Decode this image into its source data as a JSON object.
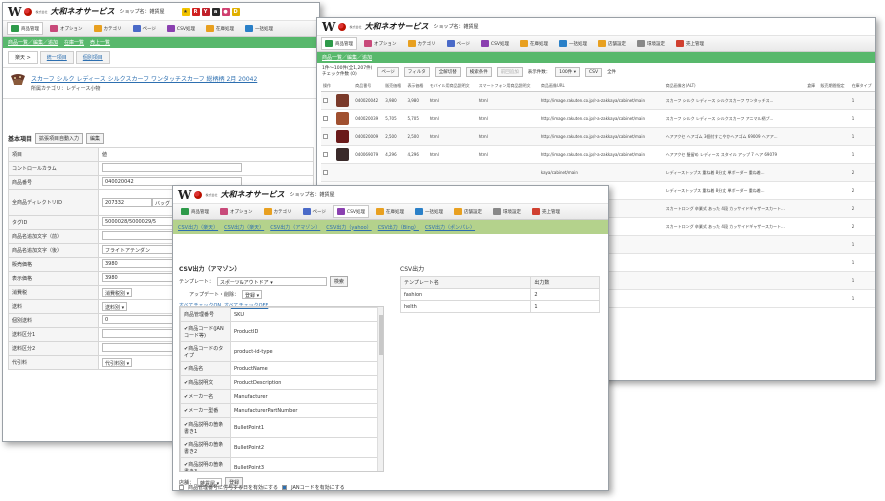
{
  "brand": {
    "w_logo": "W",
    "small": "株式会社",
    "name": "大和ネオサービス",
    "shop_label": "ショップ名：雑貨屋"
  },
  "tools": [
    {
      "glyph": "★",
      "color": "#e0a000"
    },
    {
      "glyph": "R",
      "color": "#d02020"
    },
    {
      "glyph": "Y",
      "color": "#c0202a"
    },
    {
      "glyph": "a",
      "color": "#2a2a2a"
    },
    {
      "glyph": "●",
      "color": "#d04070"
    },
    {
      "glyph": "D",
      "color": "#e0b000"
    }
  ],
  "menu": [
    {
      "label": "商品管理",
      "color": "#2e9a4a"
    },
    {
      "label": "オプション",
      "color": "#c84a7a"
    },
    {
      "label": "カテゴリ",
      "color": "#e8a020"
    },
    {
      "label": "ページ",
      "color": "#4a6ac8"
    },
    {
      "label": "CSV処理",
      "color": "#8a40b0"
    },
    {
      "label": "在庫処理",
      "color": "#e8a020"
    },
    {
      "label": "一括処理",
      "color": "#2a80c8"
    },
    {
      "label": "店舗設定",
      "color": "#e8a020"
    },
    {
      "label": "環境設定",
      "color": "#888888"
    },
    {
      "label": "売上管理",
      "color": "#d04030"
    }
  ],
  "win1": {
    "breadcrumb": [
      "商品一覧／編集／追加",
      "在庫一覧",
      "売上一覧"
    ],
    "subtabs": [
      "楽天 >",
      "統一項目",
      "個別項目"
    ],
    "product_title": "スカーフ シルク レディース シルクスカーフ ワンタッチスカーフ 総柄柄 2月 20042",
    "category": "所属カテゴリ：レディース小物",
    "section": "基本項目",
    "btn_auto": "拡張項目自動入力",
    "btn_edit": "編集",
    "rows": [
      {
        "label": "項目",
        "value": "値"
      },
      {
        "label": "コントロールカラム",
        "value": ""
      },
      {
        "label": "商品番号",
        "value": "040020042"
      },
      {
        "label": "全商品ディレクトリID",
        "value": "207332\nバッグ・小物・ブラン"
      },
      {
        "label": "タグID",
        "value": "5000028/5000029/5"
      },
      {
        "label": "商品名追加文字（前）",
        "value": ""
      },
      {
        "label": "商品名追加文字（後）",
        "value": "フライトアテンダン"
      },
      {
        "label": "販売価格",
        "value": "3980"
      },
      {
        "label": "表示価格",
        "value": "3980"
      },
      {
        "label": "消費税",
        "value": "消費税別 ▾"
      },
      {
        "label": "送料",
        "value": "送料別 ▾"
      },
      {
        "label": "個別送料",
        "value": "0"
      },
      {
        "label": "送料区分1",
        "value": ""
      },
      {
        "label": "送料区分2",
        "value": ""
      },
      {
        "label": "代引料",
        "value": "代引料別 ▾"
      }
    ]
  },
  "win2": {
    "breadcrumb": "商品一覧／編集／追加",
    "count_line1": "1件〜100件(全1,207件)",
    "count_line2": "チェック件数 (0)",
    "buttons": [
      "ページ",
      "フィルタ",
      "全解切替",
      "検索条件"
    ],
    "btn_disabled": "前回追加",
    "display_label": "表示件数：",
    "display_value": "100件 ▾",
    "csv_btn": "CSV",
    "all_label": "全件",
    "headers": [
      "操作",
      "",
      "商品番号",
      "販売価格",
      "表示価格",
      "モバイル用商品説明文",
      "スマートフォン用商品説明文",
      "商品画像URL",
      "",
      "商品画像名(ALT)",
      "",
      "倉庫",
      "販売期間指定",
      "在庫タイプ",
      "在庫数表示",
      "項目選"
    ],
    "rows": [
      {
        "id": "040020042",
        "price": "3,980",
        "disp": "3,980",
        "mob": "html",
        "sp": "html",
        "url": "http://image.rakuten.co.jp/r-a-zakkaya/cabinet/main",
        "alt": "スカーフ シルク レディース シルクスカーフ ワンタッチス...",
        "stock": "1",
        "opt": "",
        "thumb": "#7a3a2a"
      },
      {
        "id": "040020039",
        "price": "5,705",
        "disp": "5,705",
        "mob": "html",
        "sp": "html",
        "url": "http://image.rakuten.co.jp/r-a-zakkaya/cabinet/main",
        "alt": "スカーフ シルク レディース シルクスカーフ アニマル柄プ...",
        "stock": "1",
        "opt": "",
        "thumb": "#a05030"
      },
      {
        "id": "040020009",
        "price": "2,500",
        "disp": "2,500",
        "mob": "html",
        "sp": "html",
        "url": "http://image.rakuten.co.jp/r-a-zakkaya/cabinet/main",
        "alt": "ヘアアクセ ヘアゴム 3個付すこやかヘアゴム 69009 ヘアア...",
        "stock": "1",
        "opt": "",
        "thumb": "#6a1a1a"
      },
      {
        "id": "040069079",
        "price": "4,296",
        "disp": "4,296",
        "mob": "html",
        "sp": "html",
        "url": "http://image.rakuten.co.jp/r-a-zakkaya/cabinet/main",
        "alt": "ヘアアクセ 髪留め レディース スタイル アップ 7 ヘア 69079",
        "stock": "1",
        "opt": "",
        "thumb": "#3a2a2a"
      },
      {
        "id": "",
        "price": "",
        "disp": "",
        "mob": "",
        "sp": "",
        "url": "kaya/cabinet/main",
        "alt": "レディーストップス 重ね着 8分丈 単ボーダー 重ね着...",
        "stock": "2",
        "opt": "サイズ",
        "thumb": ""
      },
      {
        "id": "",
        "price": "",
        "disp": "",
        "mob": "",
        "sp": "",
        "url": "kaya/cabinet/main",
        "alt": "レディーストップス 重ね着 8分丈 単ボーダー 重ね着...",
        "stock": "2",
        "opt": "サイズ",
        "thumb": ""
      },
      {
        "id": "",
        "price": "",
        "disp": "",
        "mob": "",
        "sp": "",
        "url": "kaya/cabinet/main",
        "alt": "スカートロング 卒業式 あった 4段 カッサイドギャザースカート...",
        "stock": "2",
        "opt": "サイズ",
        "thumb": ""
      },
      {
        "id": "",
        "price": "",
        "disp": "",
        "mob": "",
        "sp": "",
        "url": "kaya/cabinet/main",
        "alt": "スカートロング 卒業式 あった 4段 カッサイドギャザースカート...",
        "stock": "2",
        "opt": "サイズ",
        "thumb": ""
      },
      {
        "id": "",
        "price": "",
        "disp": "",
        "mob": "",
        "sp": "",
        "url": "kaya/cabinet/1030",
        "alt": "",
        "stock": "1",
        "opt": "",
        "thumb": ""
      },
      {
        "id": "",
        "price": "",
        "disp": "",
        "mob": "",
        "sp": "",
        "url": "kaya/cabinet/1030",
        "alt": "",
        "stock": "1",
        "opt": "",
        "thumb": ""
      },
      {
        "id": "",
        "price": "",
        "disp": "",
        "mob": "",
        "sp": "",
        "url": "kaya/cabinet/1030",
        "alt": "",
        "stock": "1",
        "opt": "",
        "thumb": ""
      },
      {
        "id": "",
        "price": "",
        "disp": "",
        "mob": "",
        "sp": "",
        "url": "kaya/cabinet/1030",
        "alt": "",
        "stock": "1",
        "opt": "",
        "thumb": ""
      }
    ]
  },
  "win3": {
    "csv_links": [
      "CSV出力（楽天）",
      "CSV出力（楽天）",
      "CSV出力（アマゾン）",
      "CSV出力（yahoo）",
      "CSV出力（Bing）",
      "CSV出力（ポンパレ）"
    ],
    "title": "CSV出力（アマゾン）",
    "template_label": "テンプレート：",
    "template_value": "スポーツ&アウトドア ▾",
    "search_btn": "検索",
    "update_label": "アップデート・削除：",
    "update_value": "登録 ▾",
    "check_all": "すべてチェックON",
    "uncheck_all": "すべてチェックOFF",
    "fields": [
      {
        "label": "商品管理番号",
        "value": "SKU",
        "tall": false
      },
      {
        "label": "✔商品コード(JANコード等)",
        "value": "ProductID",
        "tall": true
      },
      {
        "label": "✔商品コードのタイプ",
        "value": "product-id-type",
        "tall": true
      },
      {
        "label": "✔商品名",
        "value": "ProductName",
        "tall": false
      },
      {
        "label": "✔商品説明文",
        "value": "ProductDescription",
        "tall": false
      },
      {
        "label": "✔メーカー名",
        "value": "Manufacturer",
        "tall": false
      },
      {
        "label": "✔メーカー型番",
        "value": "ManufacturerPartNumber",
        "tall": false
      },
      {
        "label": "✔商品説明の箇条書き1",
        "value": "BulletPoint1",
        "tall": true
      },
      {
        "label": "✔商品説明の箇条書き2",
        "value": "BulletPoint2",
        "tall": true
      },
      {
        "label": "✔商品説明の箇条書き3",
        "value": "BulletPoint3",
        "tall": true
      }
    ],
    "right_title": "CSV出力",
    "tpl_head": [
      "テンプレート名",
      "出力数"
    ],
    "tpl_rows": [
      [
        "fashion",
        "2"
      ],
      [
        "helth",
        "1"
      ]
    ],
    "footer_label": "店舗：",
    "footer_select": "雑貨屋 ▾",
    "footer_btn": "登録",
    "footer_check1": "商品管理番号に付与する日を有効にする",
    "footer_check2": "JANコードを有効にする"
  }
}
